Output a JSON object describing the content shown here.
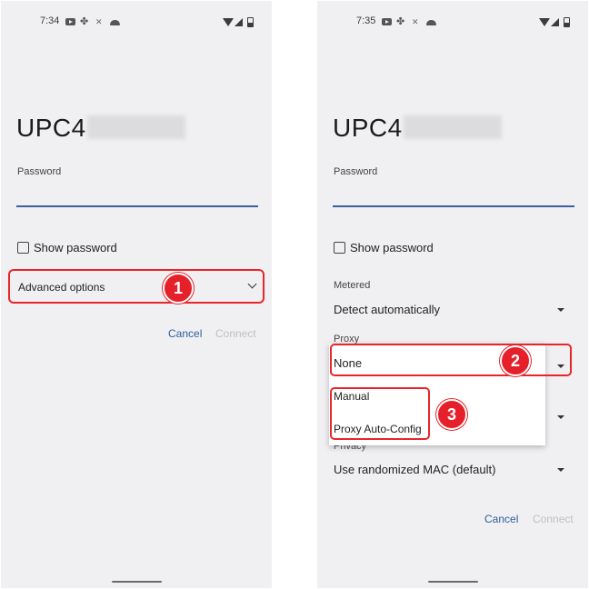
{
  "screens": [
    {
      "status_bar": {
        "time": "7:34",
        "left_icons": [
          "youtube-icon",
          "fan-icon",
          "dots-icon",
          "cloud-icon"
        ],
        "right_icons": [
          "wifi-icon",
          "signal-icon",
          "battery-icon"
        ]
      },
      "network_name": "UPC4",
      "password_label": "Password",
      "password_value": "",
      "show_password_label": "Show password",
      "show_password_checked": false,
      "advanced_options_label": "Advanced options",
      "badge": "1",
      "cancel_label": "Cancel",
      "connect_label": "Connect"
    },
    {
      "status_bar": {
        "time": "7:35",
        "left_icons": [
          "youtube-icon",
          "fan-icon",
          "dots-icon",
          "cloud-icon"
        ],
        "right_icons": [
          "wifi-icon",
          "signal-icon",
          "battery-icon"
        ]
      },
      "network_name": "UPC4",
      "password_label": "Password",
      "password_value": "",
      "show_password_label": "Show password",
      "show_password_checked": false,
      "metered_label": "Metered",
      "metered_value": "Detect automatically",
      "proxy_label": "Proxy",
      "proxy_value": "None",
      "proxy_options": [
        "None",
        "Manual",
        "Proxy Auto-Config"
      ],
      "privacy_label": "Privacy",
      "privacy_value": "Use randomized MAC (default)",
      "badge_proxy": "2",
      "badge_options": "3",
      "cancel_label": "Cancel",
      "connect_label": "Connect"
    }
  ],
  "colors": {
    "panel_bg": "#f0f0f3",
    "accent_blue": "#2e5d9c",
    "highlight_red": "#e5202a",
    "disabled_text": "#c0c0c4"
  }
}
